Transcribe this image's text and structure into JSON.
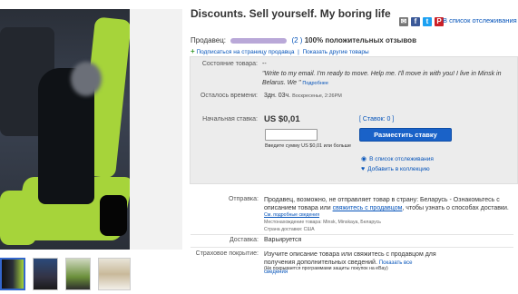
{
  "listing": {
    "title": "Discounts. Sell yourself. My boring life"
  },
  "share": {
    "icons": [
      {
        "name": "email-icon",
        "color": "#777777",
        "glyph": "✉"
      },
      {
        "name": "facebook-icon",
        "color": "#3b5998",
        "glyph": "f"
      },
      {
        "name": "twitter-icon",
        "color": "#1da1f2",
        "glyph": "t"
      },
      {
        "name": "pinterest-icon",
        "color": "#cb2027",
        "glyph": "P"
      }
    ],
    "watch_label": "В список отслеживания"
  },
  "seller": {
    "label": "Продавец",
    "feedback_count": "(2 )",
    "positive": "100% положительных отзывов",
    "subscribe": "Подписаться на страницу продавца",
    "other_items": "Показать другие товары"
  },
  "item": {
    "condition_label": "Состояние товара:",
    "condition_value": "--",
    "condition_quote": "\"Write to my email. I'm ready to move. Help me. I'll move in with you! I live in Minsk in Belarus. We \"",
    "condition_more": "Подробнее",
    "time_label": "Осталось времени:",
    "time_value": "3дн. 03ч.",
    "time_end": "Воскресенье, 2:26PM",
    "bid_label": "Начальная ставка:",
    "price": "US $0,01",
    "bids": "[ Ставок: 0 ]",
    "bid_button": "Разместить ставку",
    "bid_hint": "Введите сумму US $0,01 или больше",
    "watch_link": "В список отслеживания",
    "collection_link": "Добавить в коллекцию"
  },
  "shipping": {
    "label": "Отправка:",
    "text_before": "Продавец, возможно, не отправляет товар в страну: Беларусь - Ознакомьтесь с описанием товара или ",
    "contact_link": "свяжитесь с продавцом",
    "text_after": ", чтобы узнать о способах доставки.",
    "details_link": "См. подробные сведения",
    "location": "Местонахождение товара: Minsk, Minskaya, Беларусь",
    "ships_to": "Страна доставки: США",
    "delivery_label": "Доставка:",
    "delivery_value": "Варьируется",
    "insurance_label": "Страховое покрытие:",
    "insurance_text": "Изучите описание товара или свяжитесь с продавцом для получения дополнительных сведений.",
    "insurance_link": "Показать все сведения",
    "insurance_note": "(Не покрывается программами защиты покупок на eBay)"
  },
  "colors": {
    "link": "#0654ba",
    "bid_button": "#1a62c8",
    "seat_green": "#a6d43a"
  }
}
